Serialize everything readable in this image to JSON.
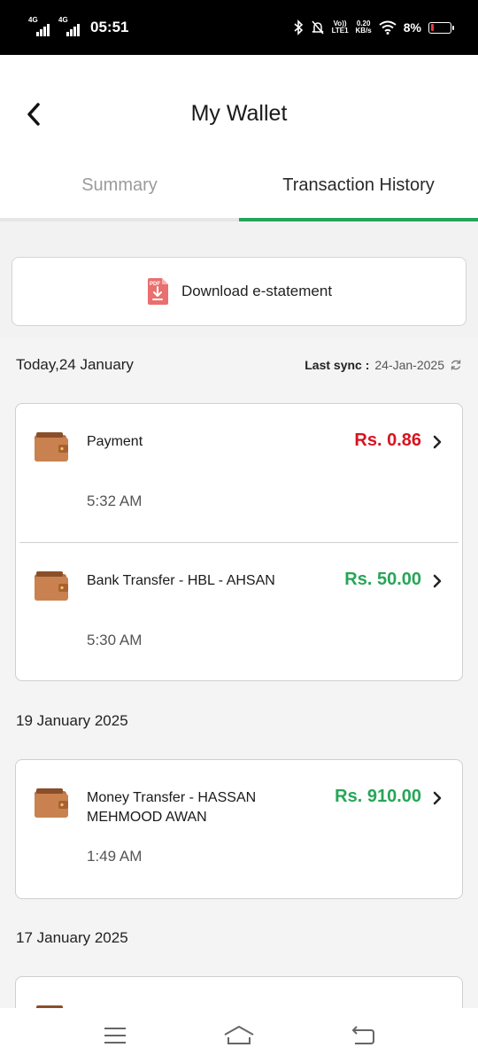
{
  "status_bar": {
    "network1": "4G",
    "network2": "4G",
    "time": "05:51",
    "volte": "Vo))",
    "lte": "LTE1",
    "speed_value": "0.20",
    "speed_unit": "KB/s",
    "battery_pct": "8%",
    "battery_level": 0.08,
    "icons": [
      "bluetooth-icon",
      "mute-icon",
      "wifi-icon",
      "battery-icon"
    ]
  },
  "header": {
    "title": "My Wallet",
    "back_icon": "chevron-left-icon"
  },
  "tabs": [
    {
      "label": "Summary",
      "active": false
    },
    {
      "label": "Transaction History",
      "active": true
    }
  ],
  "download": {
    "label": "Download e-statement",
    "icon": "pdf-download-icon",
    "icon_text": "PDF"
  },
  "sync": {
    "label": "Last sync :",
    "value": "24-Jan-2025",
    "icon": "refresh-icon"
  },
  "groups": [
    {
      "date": "Today,24 January",
      "transactions": [
        {
          "title": "Payment",
          "time": "5:32 AM",
          "amount": "Rs. 0.86",
          "type": "debit"
        },
        {
          "title": "Bank Transfer - HBL - AHSAN",
          "time": "5:30 AM",
          "amount": "Rs. 50.00",
          "type": "credit"
        }
      ]
    },
    {
      "date": "19 January 2025",
      "transactions": [
        {
          "title": "Money Transfer - HASSAN MEHMOOD AWAN",
          "time": "1:49 AM",
          "amount": "Rs. 910.00",
          "type": "credit"
        }
      ]
    },
    {
      "date": "17 January 2025",
      "transactions": []
    }
  ],
  "colors": {
    "accent": "#22a65a",
    "debit": "#d7141f",
    "credit": "#26a657",
    "wallet": "#c27a49"
  },
  "nav_bar": {
    "icons": [
      "menu-icon",
      "home-icon",
      "back-icon"
    ]
  }
}
